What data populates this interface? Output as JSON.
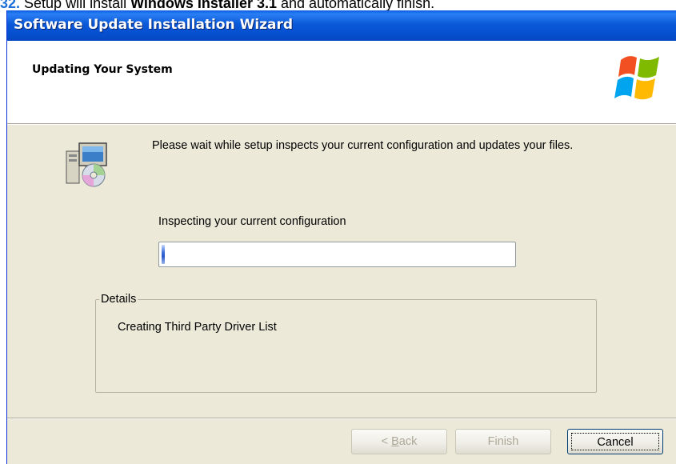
{
  "document": {
    "step_number": "32.",
    "text_before": " Setup will install ",
    "bold_text": "Windows Installer 3.1",
    "text_after": " and automatically finish."
  },
  "window": {
    "title": "Software Update Installation Wizard"
  },
  "header": {
    "title": "Updating Your System",
    "logo_icon": "windows-flag-logo"
  },
  "body": {
    "setup_icon": "setup-computer-cd-icon",
    "message": "Please wait while setup inspects your current configuration and updates your files.",
    "status": "Inspecting your current configuration",
    "progress_fraction": 0.0
  },
  "details": {
    "legend": "Details",
    "text": "Creating Third Party Driver List"
  },
  "buttons": {
    "back_prefix": "< ",
    "back_accel": "B",
    "back_rest": "ack",
    "finish": "Finish",
    "cancel": "Cancel"
  },
  "colors": {
    "titlebar": "#0a59d8",
    "dialog_bg": "#ece9d8",
    "progress_fill": "#2a57c8",
    "step_number": "#1c6fd8"
  }
}
